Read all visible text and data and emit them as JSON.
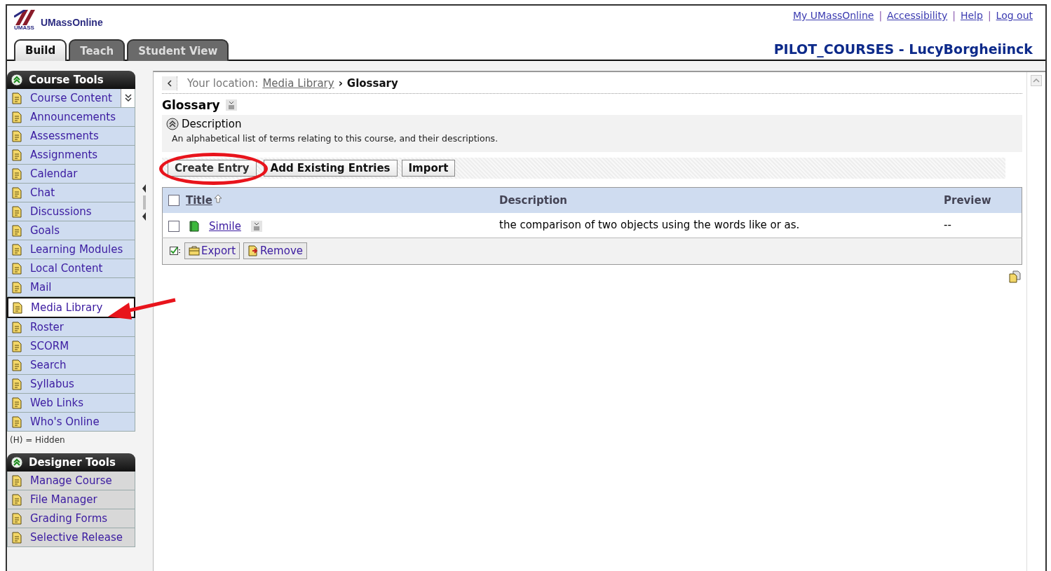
{
  "logo": {
    "text": "UMassOnline",
    "mark": "UMASS"
  },
  "top_links": [
    "My UMassOnline",
    "Accessibility",
    "Help",
    "Log out"
  ],
  "link_separator": "|",
  "course_title": "PILOT_COURSES - LucyBorgheiinck",
  "tabs": [
    {
      "label": "Build",
      "selected": true
    },
    {
      "label": "Teach",
      "selected": false
    },
    {
      "label": "Student View",
      "selected": false
    }
  ],
  "course_tools": {
    "title": "Course Tools",
    "items": [
      {
        "label": "Course Content",
        "selected": false,
        "has_menu": true
      },
      {
        "label": "Announcements",
        "selected": false,
        "has_menu": false
      },
      {
        "label": "Assessments",
        "selected": false,
        "has_menu": false
      },
      {
        "label": "Assignments",
        "selected": false,
        "has_menu": false
      },
      {
        "label": "Calendar",
        "selected": false,
        "has_menu": false
      },
      {
        "label": "Chat",
        "selected": false,
        "has_menu": false
      },
      {
        "label": "Discussions",
        "selected": false,
        "has_menu": false
      },
      {
        "label": "Goals",
        "selected": false,
        "has_menu": false
      },
      {
        "label": "Learning Modules",
        "selected": false,
        "has_menu": false
      },
      {
        "label": "Local Content",
        "selected": false,
        "has_menu": false
      },
      {
        "label": "Mail",
        "selected": false,
        "has_menu": false
      },
      {
        "label": "Media Library",
        "selected": true,
        "has_menu": false
      },
      {
        "label": "Roster",
        "selected": false,
        "has_menu": false
      },
      {
        "label": "SCORM",
        "selected": false,
        "has_menu": false
      },
      {
        "label": "Search",
        "selected": false,
        "has_menu": false
      },
      {
        "label": "Syllabus",
        "selected": false,
        "has_menu": false
      },
      {
        "label": "Web Links",
        "selected": false,
        "has_menu": false
      },
      {
        "label": "Who's Online",
        "selected": false,
        "has_menu": false
      }
    ]
  },
  "hidden_note": "(H) = Hidden",
  "designer_tools": {
    "title": "Designer Tools",
    "items": [
      {
        "label": "Manage Course",
        "selected": false,
        "has_menu": false
      },
      {
        "label": "File Manager",
        "selected": false,
        "has_menu": false
      },
      {
        "label": "Grading Forms",
        "selected": false,
        "has_menu": false
      },
      {
        "label": "Selective Release",
        "selected": false,
        "has_menu": false
      }
    ]
  },
  "breadcrumb": {
    "prefix": "Your location:",
    "link": "Media Library",
    "separator": "›",
    "current": "Glossary"
  },
  "page_title": "Glossary",
  "description": {
    "heading": "Description",
    "text": "An alphabetical list of terms relating to this course, and their descriptions."
  },
  "actions": [
    {
      "label": "Create Entry",
      "highlighted": true
    },
    {
      "label": "Add Existing Entries",
      "highlighted": false
    },
    {
      "label": "Import",
      "highlighted": false
    }
  ],
  "table": {
    "select_all": false,
    "columns": [
      {
        "label": "Title",
        "sortable": true
      },
      {
        "label": "Description",
        "sortable": false
      },
      {
        "label": "Preview",
        "sortable": false
      }
    ],
    "rows": [
      {
        "checked": false,
        "title": "Simile",
        "description": "the comparison of two objects using the words like or as.",
        "preview": "--"
      }
    ]
  },
  "footer_actions": [
    "Export",
    "Remove"
  ]
}
